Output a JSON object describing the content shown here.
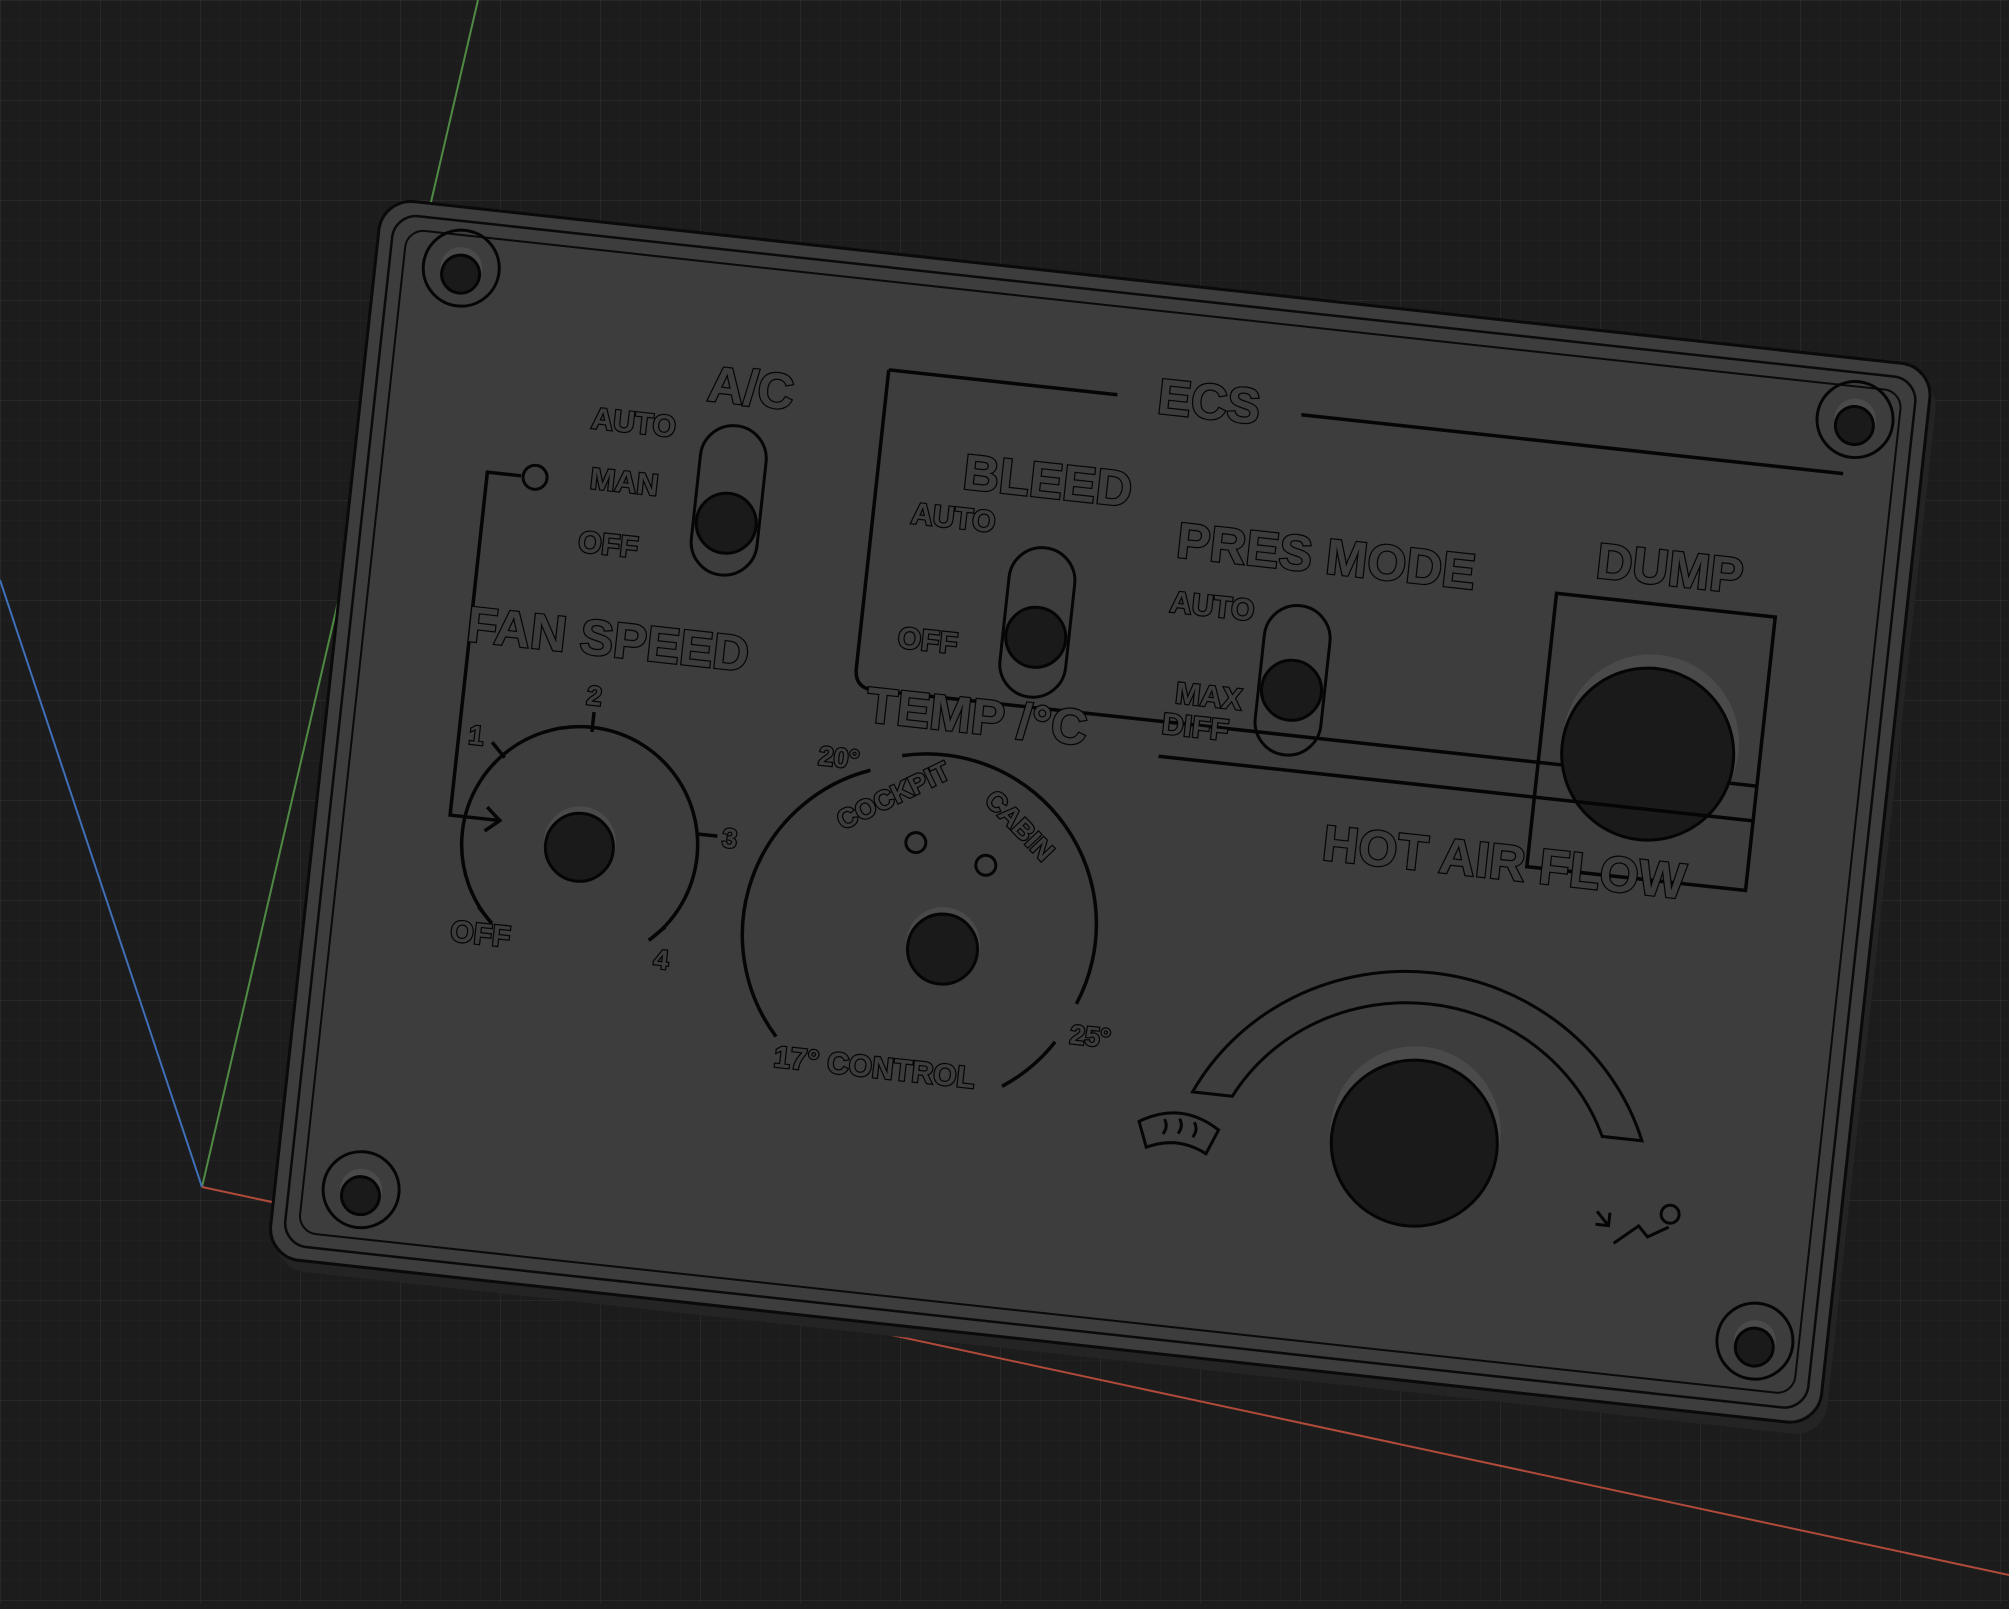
{
  "panel": {
    "ecs_label": "ECS",
    "ac": {
      "title": "A/C",
      "auto": "AUTO",
      "man": "MAN",
      "off": "OFF"
    },
    "bleed": {
      "title": "BLEED",
      "auto": "AUTO",
      "off": "OFF"
    },
    "pres_mode": {
      "title": "PRES MODE",
      "auto": "AUTO",
      "max": "MAX",
      "diff": "DIFF"
    },
    "dump": {
      "title": "DUMP"
    },
    "fan_speed": {
      "title": "FAN SPEED",
      "off": "OFF",
      "s1": "1",
      "s2": "2",
      "s3": "3",
      "s4": "4"
    },
    "temp": {
      "title": "TEMP /°C",
      "t20": "20°",
      "cockpit": "COCKPIT",
      "cabin": "CABIN",
      "t25": "25°",
      "t17": "17° CONTROL"
    },
    "hot_air": {
      "title": "HOT AIR FLOW",
      "windshield_icon": "windshield-defrost-icon",
      "foot_icon": "foot-heat-icon"
    }
  },
  "colors": {
    "background": "#1c1c1c",
    "grid": "#2a2a2a",
    "panel_face": "#3d3d3d",
    "engraving": "#050505",
    "axis_x": "#b04a3a",
    "axis_y": "#4f8a45",
    "axis_z": "#3f6fb8"
  }
}
